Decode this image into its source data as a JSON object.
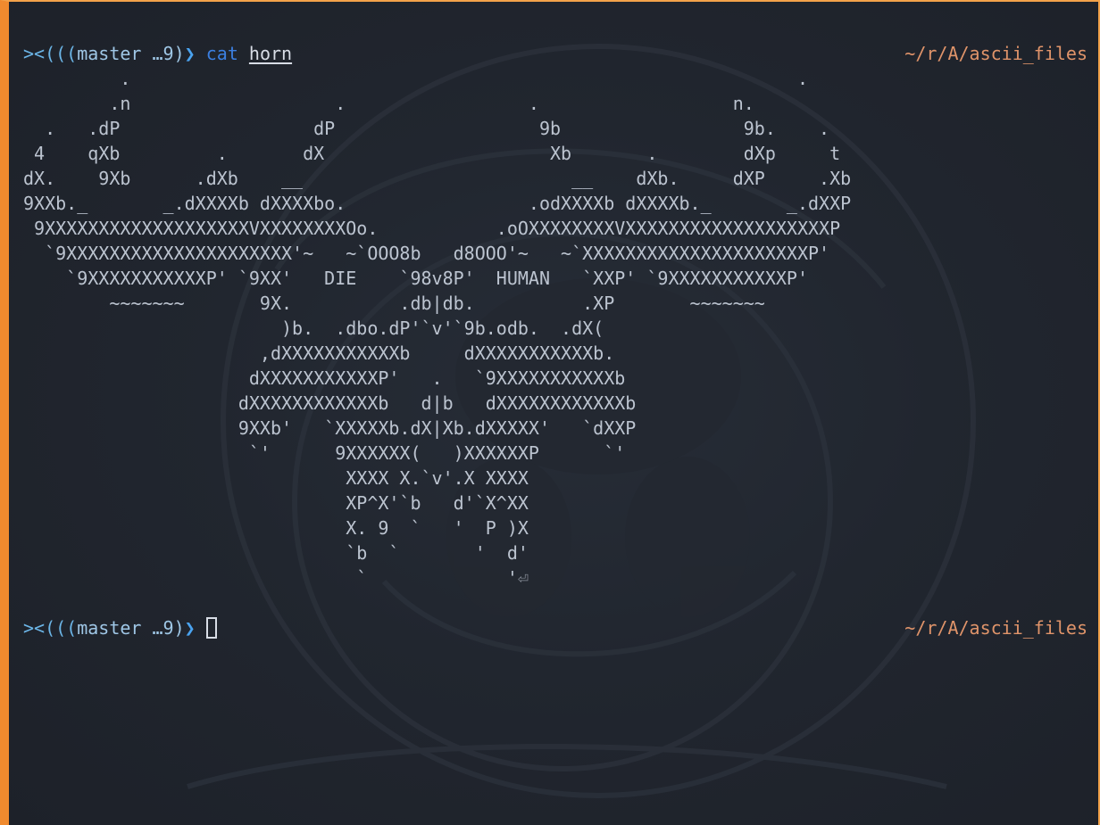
{
  "terminal": {
    "prompt_fish": "><(((",
    "prompt_branch": "master …9)",
    "prompt_arrow": "❯",
    "cwd": "~/r/A/ascii_files",
    "command": {
      "name": "cat",
      "arg": "horn"
    },
    "output_lines": [
      "         .                                                              .",
      "        .n                   .                 .                  n.",
      "  .   .dP                  dP                   9b                 9b.    .",
      " 4    qXb         .       dX                     Xb       .        dXp     t",
      "dX.    9Xb      .dXb    __                         __    dXb.     dXP     .Xb",
      "9XXb._       _.dXXXXb dXXXXbo.                 .odXXXXb dXXXXb._       _.dXXP",
      " 9XXXXXXXXXXXXXXXXXXXVXXXXXXXXOo.           .oOXXXXXXXXVXXXXXXXXXXXXXXXXXXXP",
      "  `9XXXXXXXXXXXXXXXXXXXXX'~   ~`OOO8b   d8OOO'~   ~`XXXXXXXXXXXXXXXXXXXXXP'",
      "    `9XXXXXXXXXXXP' `9XX'   DIE    `98v8P'  HUMAN   `XXP' `9XXXXXXXXXXXP'",
      "        ~~~~~~~       9X.          .db|db.          .XP       ~~~~~~~",
      "                        )b.  .dbo.dP'`v'`9b.odb.  .dX(",
      "                      ,dXXXXXXXXXXXb     dXXXXXXXXXXXb.",
      "                     dXXXXXXXXXXXP'   .   `9XXXXXXXXXXXb",
      "                    dXXXXXXXXXXXXb   d|b   dXXXXXXXXXXXXb",
      "                    9XXb'   `XXXXXb.dX|Xb.dXXXXX'   `dXXP",
      "                     `'      9XXXXXX(   )XXXXXXP      `'",
      "                              XXXX X.`v'.X XXXX",
      "                              XP^X'`b   d'`X^XX",
      "                              X. 9  `   '  P )X",
      "                              `b  `       '  d'",
      "                               `             '"
    ],
    "return_symbol": "⏎"
  }
}
